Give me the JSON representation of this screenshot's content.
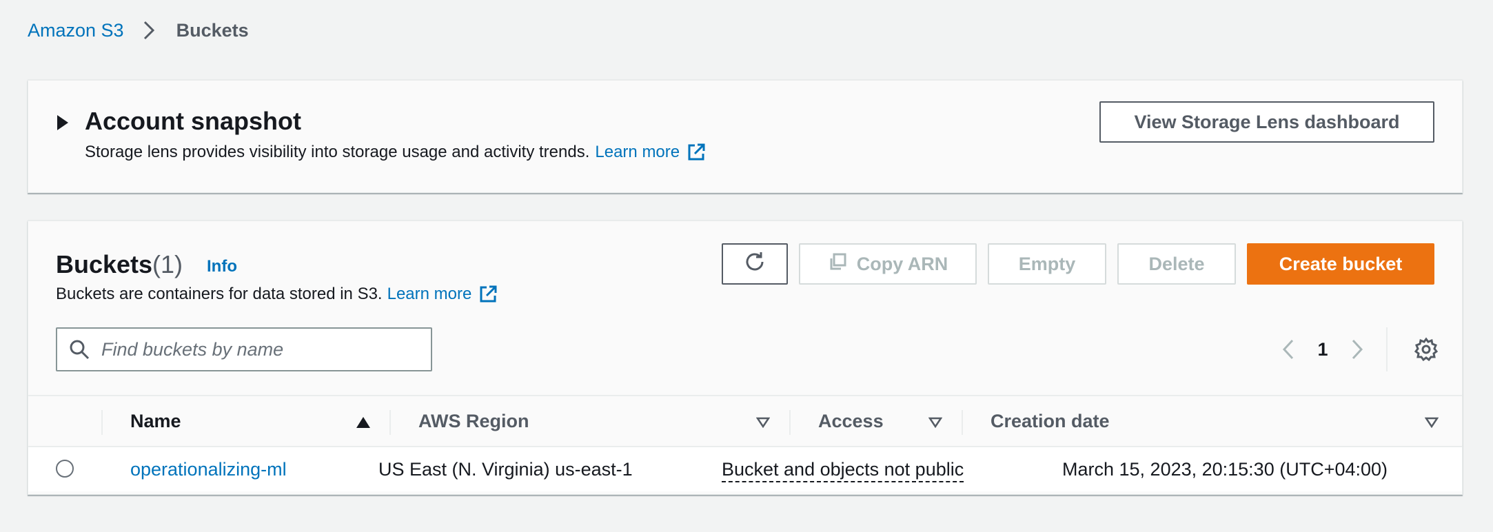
{
  "breadcrumb": {
    "root": "Amazon S3",
    "current": "Buckets"
  },
  "snapshot": {
    "title": "Account snapshot",
    "description": "Storage lens provides visibility into storage usage and activity trends.",
    "learn_more": "Learn more",
    "storage_lens_button": "View Storage Lens dashboard"
  },
  "buckets": {
    "title": "Buckets",
    "count": "(1)",
    "info": "Info",
    "description": "Buckets are containers for data stored in S3.",
    "learn_more": "Learn more",
    "actions": {
      "copy_arn": "Copy ARN",
      "empty": "Empty",
      "delete": "Delete",
      "create": "Create bucket"
    },
    "search_placeholder": "Find buckets by name",
    "page": "1",
    "columns": {
      "name": "Name",
      "region": "AWS Region",
      "access": "Access",
      "created": "Creation date"
    },
    "rows": [
      {
        "name": "operationalizing-ml",
        "region": "US East (N. Virginia) us-east-1",
        "access": "Bucket and objects not public",
        "created": "March 15, 2023, 20:15:30 (UTC+04:00)"
      }
    ]
  },
  "colors": {
    "link": "#0073bb",
    "primary_button": "#ec7211",
    "disabled": "#aab7b8",
    "background": "#f2f3f3"
  },
  "icons": [
    "chevron-right-icon",
    "caret-right-icon",
    "external-link-icon",
    "refresh-icon",
    "copy-icon",
    "search-icon",
    "chevron-left-icon",
    "gear-icon",
    "sort-ascending-icon",
    "sort-descending-icon"
  ]
}
